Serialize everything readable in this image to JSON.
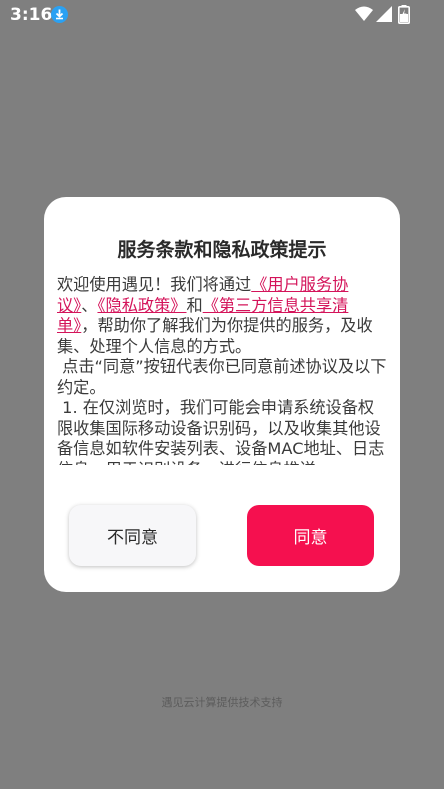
{
  "status_bar": {
    "time": "3:16",
    "icons": [
      "download-icon",
      "wifi-icon",
      "signal-icon",
      "battery-charging-icon"
    ]
  },
  "dialog": {
    "title": "服务条款和隐私政策提示",
    "body": {
      "p1_intro": "欢迎使用遇见！我们将通过",
      "link_user_agreement": "《用户服务协议》",
      "sep1": "、",
      "link_privacy_policy": "《隐私政策》",
      "sep2": "和",
      "link_third_party": "《第三方信息共享清单》",
      "p1_rest": "，帮助你了解我们为你提供的服务，及收集、处理个人信息的方式。",
      "p2": "点击“同意”按钮代表你已同意前述协议及以下约定。",
      "p3": "1. 在仅浏览时，我们可能会申请系统设备权限收集国际移动设备识别码，以及收集其他设备信息如软件安装列表、设备MAC地址、日志信息，用于识别设备，进行信息推送"
    },
    "disagree_label": "不同意",
    "agree_label": "同意"
  },
  "footer": "遇见云计算提供技术支持",
  "colors": {
    "overlay": "#7f7f7f",
    "accent": "#f5104f",
    "link": "#d4145a"
  }
}
